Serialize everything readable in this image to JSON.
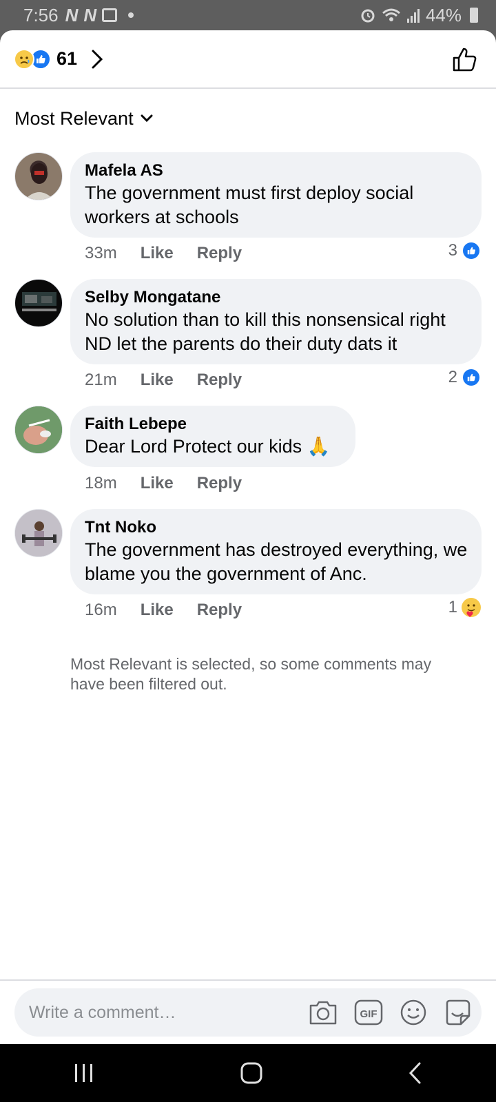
{
  "status_bar": {
    "time": "7:56",
    "battery": "44%",
    "icons": [
      "notification-n-icon",
      "notification-n-icon",
      "gallery-icon",
      "dot-icon",
      "alarm-icon",
      "wifi-icon",
      "signal-icon",
      "battery-icon"
    ]
  },
  "header": {
    "reactions": [
      "sad-emoji-icon",
      "like-emoji-icon"
    ],
    "count": "61",
    "colors": {
      "like_blue": "#1877f2",
      "sad_yellow": "#f7c948"
    }
  },
  "sort": {
    "label": "Most Relevant"
  },
  "comments": [
    {
      "author": "Mafela AS",
      "text": "The government must first deploy social workers at schools",
      "time": "33m",
      "like": "Like",
      "reply": "Reply",
      "reaction_count": "3",
      "reaction_icon": "like-icon"
    },
    {
      "author": "Selby Mongatane",
      "text": "No solution than to kill this nonsensical right ND let the parents do their duty dats it",
      "time": "21m",
      "like": "Like",
      "reply": "Reply",
      "reaction_count": "2",
      "reaction_icon": "like-icon"
    },
    {
      "author": "Faith Lebepe",
      "text": "Dear Lord Protect our kids 🙏",
      "time": "18m",
      "like": "Like",
      "reply": "Reply"
    },
    {
      "author": "Tnt Noko",
      "text": "The government has destroyed everything, we blame you the  government of Anc.",
      "time": "16m",
      "like": "Like",
      "reply": "Reply",
      "reaction_count": "1",
      "reaction_icon": "care-icon"
    }
  ],
  "filtered_note": "Most Relevant is selected, so some comments may have been filtered out.",
  "composer": {
    "placeholder": "Write a comment…",
    "icons": [
      "camera-icon",
      "gif-icon",
      "emoji-icon",
      "sticker-icon"
    ]
  },
  "nav": {
    "icons": [
      "recents-icon",
      "home-icon",
      "back-icon"
    ]
  }
}
